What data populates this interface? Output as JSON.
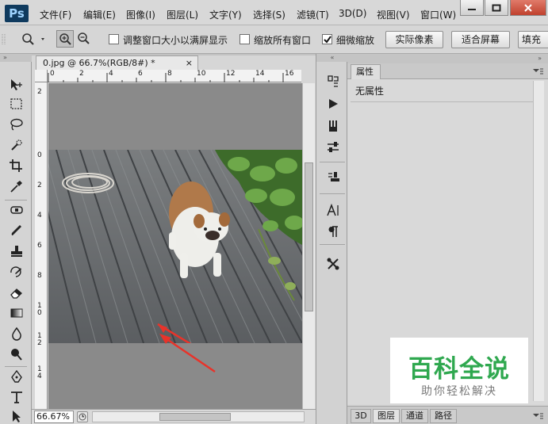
{
  "app": {
    "logo": "Ps"
  },
  "menu": [
    "文件(F)",
    "编辑(E)",
    "图像(I)",
    "图层(L)",
    "文字(Y)",
    "选择(S)",
    "滤镜(T)",
    "3D(D)",
    "视图(V)",
    "窗口(W)"
  ],
  "options": {
    "resize_windows_label": "调整窗口大小以满屏显示",
    "zoom_all_label": "缩放所有窗口",
    "scrubby_zoom_label": "细微缩放",
    "scrubby_zoom_checked": true,
    "actual_pixels": "实际像素",
    "fit_screen": "适合屏幕",
    "fill_screen": "填充"
  },
  "document": {
    "tab_title": "0.jpg @ 66.7%(RGB/8#) *",
    "tab_close": "×",
    "zoom": "66.67%",
    "ruler_top": [
      "0",
      "2",
      "4",
      "6",
      "8",
      "10",
      "12",
      "14",
      "16"
    ],
    "ruler_left": [
      "2",
      "0",
      "2",
      "4",
      "6",
      "8",
      "10",
      "12",
      "14"
    ]
  },
  "panel": {
    "tab": "属性",
    "no_properties": "无属性",
    "bottom_tabs": [
      "3D",
      "图层",
      "通道",
      "路径"
    ],
    "active_bottom_tab": "图层"
  },
  "watermark": {
    "title": "百科全说",
    "subtitle": "助你轻松解决"
  },
  "colors": {
    "canvas_bg": "#8a8a8a",
    "ui_bg": "#d6d6d6",
    "watermark_green": "#2fa84f",
    "ps_logo_bg": "#0f3a5e",
    "arrow_red": "#e8332a"
  }
}
